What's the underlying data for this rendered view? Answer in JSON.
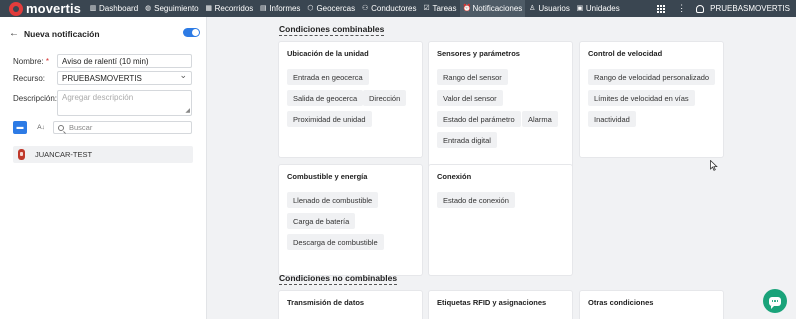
{
  "app": {
    "logo_text": "movertis"
  },
  "nav": {
    "items": [
      {
        "label": "Dashboard",
        "icon": "bar-chart-icon"
      },
      {
        "label": "Seguimiento",
        "icon": "globe-icon"
      },
      {
        "label": "Recorridos",
        "icon": "route-icon"
      },
      {
        "label": "Informes",
        "icon": "document-icon"
      },
      {
        "label": "Geocercas",
        "icon": "geofence-icon"
      },
      {
        "label": "Conductores",
        "icon": "driver-icon"
      },
      {
        "label": "Tareas",
        "icon": "checklist-icon"
      },
      {
        "label": "Notificaciones",
        "icon": "alarm-clock-icon",
        "active": true
      },
      {
        "label": "Usuarios",
        "icon": "user-icon"
      },
      {
        "label": "Unidades",
        "icon": "truck-icon"
      }
    ],
    "account_name": "PRUEBASMOVERTIS"
  },
  "panel": {
    "title": "Nueva notificación",
    "enabled": true,
    "nombre_label": "Nombre:",
    "required_mark": "*",
    "nombre_value": "Aviso de ralentí (10 min)",
    "recurso_label": "Recurso:",
    "recurso_value": "PRUEBASMOVERTIS",
    "descripcion_label": "Descripción:",
    "descripcion_placeholder": "Agregar descripción",
    "sort_label": "A↓",
    "search_placeholder": "Buscar",
    "unit_name": "JUANCAR-TEST"
  },
  "main": {
    "combinable_title": "Condiciones combinables",
    "non_combinable_title": "Condiciones no combinables",
    "cards": [
      {
        "title": "Ubicación de la unidad",
        "chips": [
          "Entrada en geocerca",
          "Salida de geocerca",
          "Dirección",
          "Proximidad de unidad"
        ]
      },
      {
        "title": "Sensores y parámetros",
        "chips": [
          "Rango del sensor",
          "Valor del sensor",
          "Estado del parámetro",
          "Alarma",
          "Entrada digital"
        ]
      },
      {
        "title": "Control de velocidad",
        "chips": [
          "Rango de velocidad personalizado",
          "Límites de velocidad en vías",
          "Inactividad"
        ]
      },
      {
        "title": "Combustible y energía",
        "chips": [
          "Llenado de combustible",
          "Carga de batería",
          "Descarga de combustible"
        ]
      },
      {
        "title": "Conexión",
        "chips": [
          "Estado de conexión"
        ]
      }
    ],
    "non_combinable_cards": [
      {
        "title": "Transmisión de datos"
      },
      {
        "title": "Etiquetas RFID y asignaciones"
      },
      {
        "title": "Otras condiciones"
      }
    ]
  },
  "colors": {
    "topbar": "#3a4651",
    "accent": "#2d7be5",
    "chat": "#1aa37a",
    "logo": "#e23c3c"
  }
}
